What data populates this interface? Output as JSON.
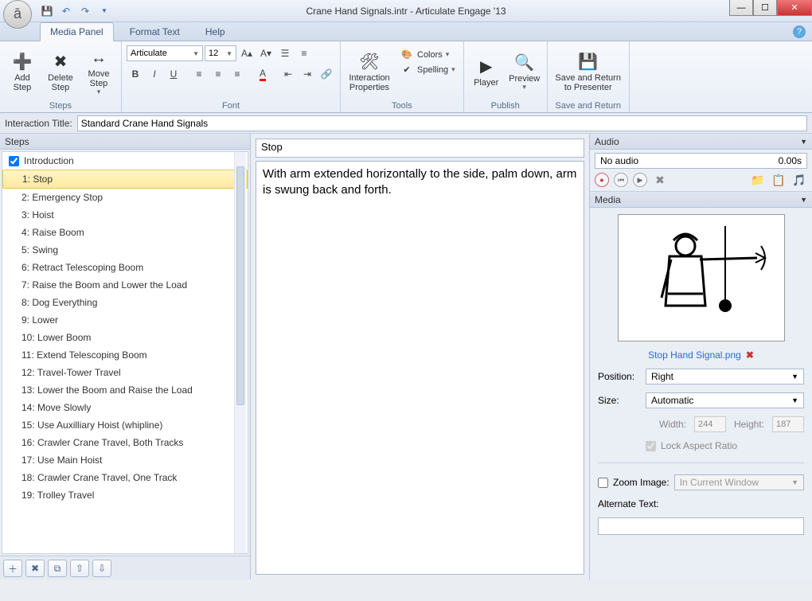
{
  "window": {
    "title": "Crane Hand Signals.intr  -  Articulate Engage '13"
  },
  "tabs": {
    "media_panel": "Media Panel",
    "format_text": "Format Text",
    "help": "Help"
  },
  "ribbon": {
    "steps_group": {
      "label": "Steps",
      "add": "Add Step",
      "delete": "Delete Step",
      "move": "Move Step"
    },
    "font_group": {
      "label": "Font",
      "font_name": "Articulate",
      "font_size": "12"
    },
    "tools_group": {
      "label": "Tools",
      "interaction_properties": "Interaction Properties",
      "colors": "Colors",
      "spelling": "Spelling"
    },
    "publish_group": {
      "label": "Publish",
      "player": "Player",
      "preview": "Preview"
    },
    "save_return_group": {
      "label": "Save and Return",
      "button": "Save and Return to Presenter"
    }
  },
  "interaction_title": {
    "label": "Interaction Title:",
    "value": "Standard Crane Hand Signals"
  },
  "steps_panel": {
    "header": "Steps",
    "introduction": "Introduction",
    "items": [
      "Stop",
      "Emergency Stop",
      "Hoist",
      "Raise Boom",
      "Swing",
      "Retract Telescoping Boom",
      "Raise the Boom and Lower the Load",
      "Dog Everything",
      "Lower",
      "Lower Boom",
      "Extend Telescoping Boom",
      "Travel-Tower Travel",
      "Lower the Boom and Raise the Load",
      "Move Slowly",
      "Use Auxilliary Hoist (whipline)",
      "Crawler Crane Travel, Both Tracks",
      "Use Main Hoist",
      "Crawler Crane Travel, One Track",
      "Trolley Travel"
    ],
    "selected_index": 0
  },
  "editor": {
    "title": "Stop",
    "body": "With arm extended horizontally to the side, palm down, arm is swung back and forth."
  },
  "audio": {
    "header": "Audio",
    "status": "No audio",
    "duration": "0.00s"
  },
  "media": {
    "header": "Media",
    "filename": "Stop Hand Signal.png",
    "position_label": "Position:",
    "position_value": "Right",
    "size_label": "Size:",
    "size_value": "Automatic",
    "width_label": "Width:",
    "width_value": "244",
    "height_label": "Height:",
    "height_value": "187",
    "lock_aspect": "Lock Aspect Ratio",
    "zoom_label": "Zoom Image:",
    "zoom_value": "In Current Window",
    "alt_label": "Alternate Text:",
    "alt_value": ""
  }
}
